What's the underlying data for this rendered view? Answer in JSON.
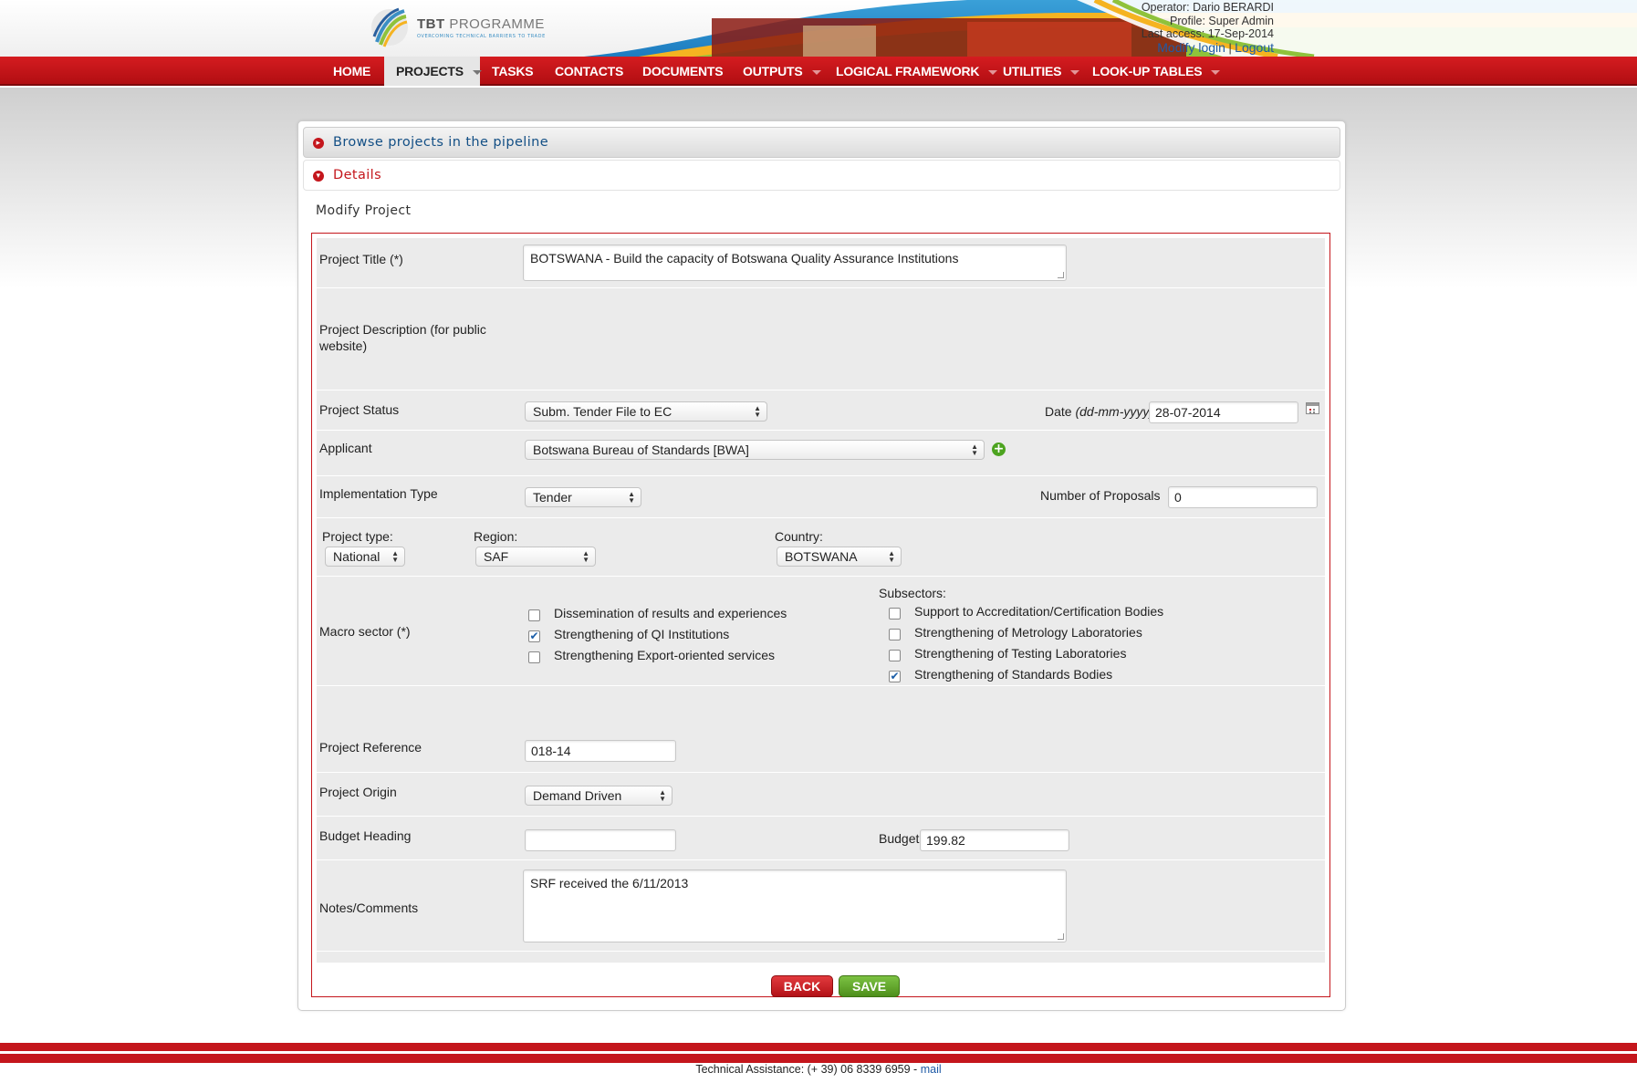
{
  "app": {
    "logo_title_bold": "TBT",
    "logo_title_rest": " PROGRAMME",
    "logo_subtitle": "OVERCOMING TECHNICAL BARRIERS TO TRADE"
  },
  "user": {
    "operator": "Operator: Dario BERARDI",
    "profile": "Profile: Super Admin",
    "last_access": "Last access: 17-Sep-2014",
    "modify_login": "Modify login",
    "separator": "|",
    "logout": "Logout"
  },
  "nav": {
    "items": [
      {
        "label": "HOME"
      },
      {
        "label": "PROJECTS"
      },
      {
        "label": "TASKS"
      },
      {
        "label": "CONTACTS"
      },
      {
        "label": "DOCUMENTS"
      },
      {
        "label": "OUTPUTS"
      },
      {
        "label": "LOGICAL FRAMEWORK"
      },
      {
        "label": "UTILITIES"
      },
      {
        "label": "LOOK-UP TABLES"
      }
    ]
  },
  "accordion": {
    "browse": "Browse projects in the pipeline",
    "details": "Details"
  },
  "form": {
    "title": "Modify Project",
    "project_title_label": "Project Title (*)",
    "project_title_value": "BOTSWANA - Build the capacity of Botswana Quality Assurance Institutions",
    "description_label_1": "Project Description (for public",
    "description_label_2": "website)",
    "status_label": "Project Status",
    "status_value": "Subm. Tender File to EC",
    "date_label": "Date",
    "date_format": "(dd-mm-yyyy)",
    "date_value": "28-07-2014",
    "applicant_label": "Applicant",
    "applicant_value": "Botswana Bureau of Standards [BWA]",
    "impl_type_label": "Implementation Type",
    "impl_type_value": "Tender",
    "num_proposals_label": "Number of Proposals",
    "num_proposals_value": "0",
    "project_type_label": "Project type:",
    "project_type_value": "National",
    "region_label": "Region:",
    "region_value": "SAF",
    "country_label": "Country:",
    "country_value": "BOTSWANA",
    "macro_sector_label": "Macro sector (*)",
    "macro_sectors": [
      {
        "label": "Dissemination of results and experiences",
        "checked": false
      },
      {
        "label": "Strengthening of QI Institutions",
        "checked": true
      },
      {
        "label": "Strengthening Export-oriented services",
        "checked": false
      }
    ],
    "subsectors_label": "Subsectors:",
    "subsectors": [
      {
        "label": "Support to Accreditation/Certification Bodies",
        "checked": false
      },
      {
        "label": "Strengthening of Metrology Laboratories",
        "checked": false
      },
      {
        "label": "Strengthening of Testing Laboratories",
        "checked": false
      },
      {
        "label": "Strengthening of Standards Bodies",
        "checked": true
      }
    ],
    "reference_label": "Project Reference",
    "reference_value": "018-14",
    "origin_label": "Project Origin",
    "origin_value": "Demand Driven",
    "budget_heading_label": "Budget Heading",
    "budget_heading_value": "",
    "budget_label": "Budget",
    "budget_value": "199.82",
    "notes_label": "Notes/Comments",
    "notes_value": "SRF received the 6/11/2013",
    "back_label": "BACK",
    "save_label": "SAVE"
  },
  "footer": {
    "text": "Technical Assistance: (+ 39) 06 8339 6959 - ",
    "mail": "mail"
  },
  "colors": {
    "brand_red": "#c4161c",
    "link_blue": "#1f5aa6",
    "save_green": "#5ea22a"
  }
}
